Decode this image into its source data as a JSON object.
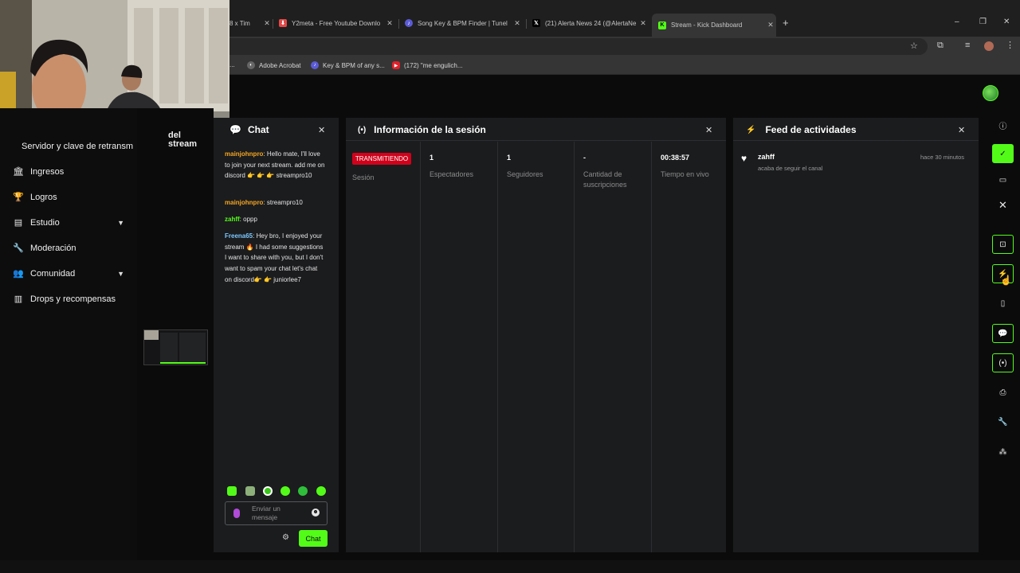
{
  "browser": {
    "tabs": [
      {
        "label": "8 x Tim",
        "favicon_color": "#1f1f1f"
      },
      {
        "label": "Y2meta - Free Youtube Downlo",
        "favicon_color": "#e44848"
      },
      {
        "label": "Song Key & BPM Finder | Tunel",
        "favicon_color": "#5b5bd6"
      },
      {
        "label": "(21) Alerta News 24 (@AlertaNe",
        "favicon_color": "#000000"
      },
      {
        "label": "Stream - Kick Dashboard",
        "favicon_color": "#53fc18",
        "active": true
      }
    ],
    "new_tab_label": "+",
    "close_label": "✕",
    "window_controls": {
      "minimize": "–",
      "restore": "❐",
      "close": "✕"
    },
    "bookmarks": [
      {
        "label": "Adobe Acrobat",
        "icon": "acrobat-icon"
      },
      {
        "label": "Key & BPM of any s...",
        "icon": "key-bpm-icon"
      },
      {
        "label": "(172) \"me engulich...",
        "icon": "youtube-icon"
      }
    ],
    "bookmark_truncated": "..."
  },
  "sidebar": {
    "partial_label": "Servidor y clave de retransm",
    "items": [
      {
        "label": "Ingresos",
        "icon": "bank-icon",
        "expandable": false
      },
      {
        "label": "Logros",
        "icon": "trophy-icon",
        "expandable": false
      },
      {
        "label": "Estudio",
        "icon": "studio-icon",
        "expandable": true
      },
      {
        "label": "Moderación",
        "icon": "wrench-icon",
        "expandable": false
      },
      {
        "label": "Comunidad",
        "icon": "people-icon",
        "expandable": true
      },
      {
        "label": "Drops y recompensas",
        "icon": "drops-icon",
        "expandable": false
      }
    ]
  },
  "midcol": {
    "partial_line1": "del",
    "partial_line2": "stream"
  },
  "chat": {
    "title": "Chat",
    "messages": [
      {
        "user": "mainjohnpro",
        "text": ": Hello mate, I'll love to join your next stream. add me on discord 👉 👉 👉 streampro10",
        "color": "u1"
      },
      {
        "user": "mainjohnpro",
        "text": ": streampro10",
        "color": "u1"
      },
      {
        "user": "zahff",
        "text": ": oppp",
        "color": "u2"
      },
      {
        "user": "Freena65",
        "text": ": Hey bro, I enjoyed your stream 🔥 I had some suggestions I want to share with you, but I don't want to spam your chat let's chat on discord👉 👉 juniorlee7",
        "color": "u3"
      }
    ],
    "input_placeholder": "Enviar un mensaje",
    "send_label": "Chat"
  },
  "session": {
    "title": "Información de la sesión",
    "status_badge": "TRANSMITIENDO",
    "status_label": "Sesión",
    "stats": [
      {
        "value": "1",
        "label": "Espectadores"
      },
      {
        "value": "1",
        "label": "Seguidores"
      },
      {
        "value": "-",
        "label": "Cantidad de suscripciones"
      },
      {
        "value": "00:38:57",
        "label": "Tiempo en vivo"
      }
    ]
  },
  "activity": {
    "title": "Feed de actividades",
    "items": [
      {
        "user": "zahff",
        "text": "acaba de seguir el canal",
        "time": "hace 30 minutos"
      }
    ]
  },
  "colors": {
    "accent": "#53fc18",
    "live_badge": "#d0021b"
  }
}
